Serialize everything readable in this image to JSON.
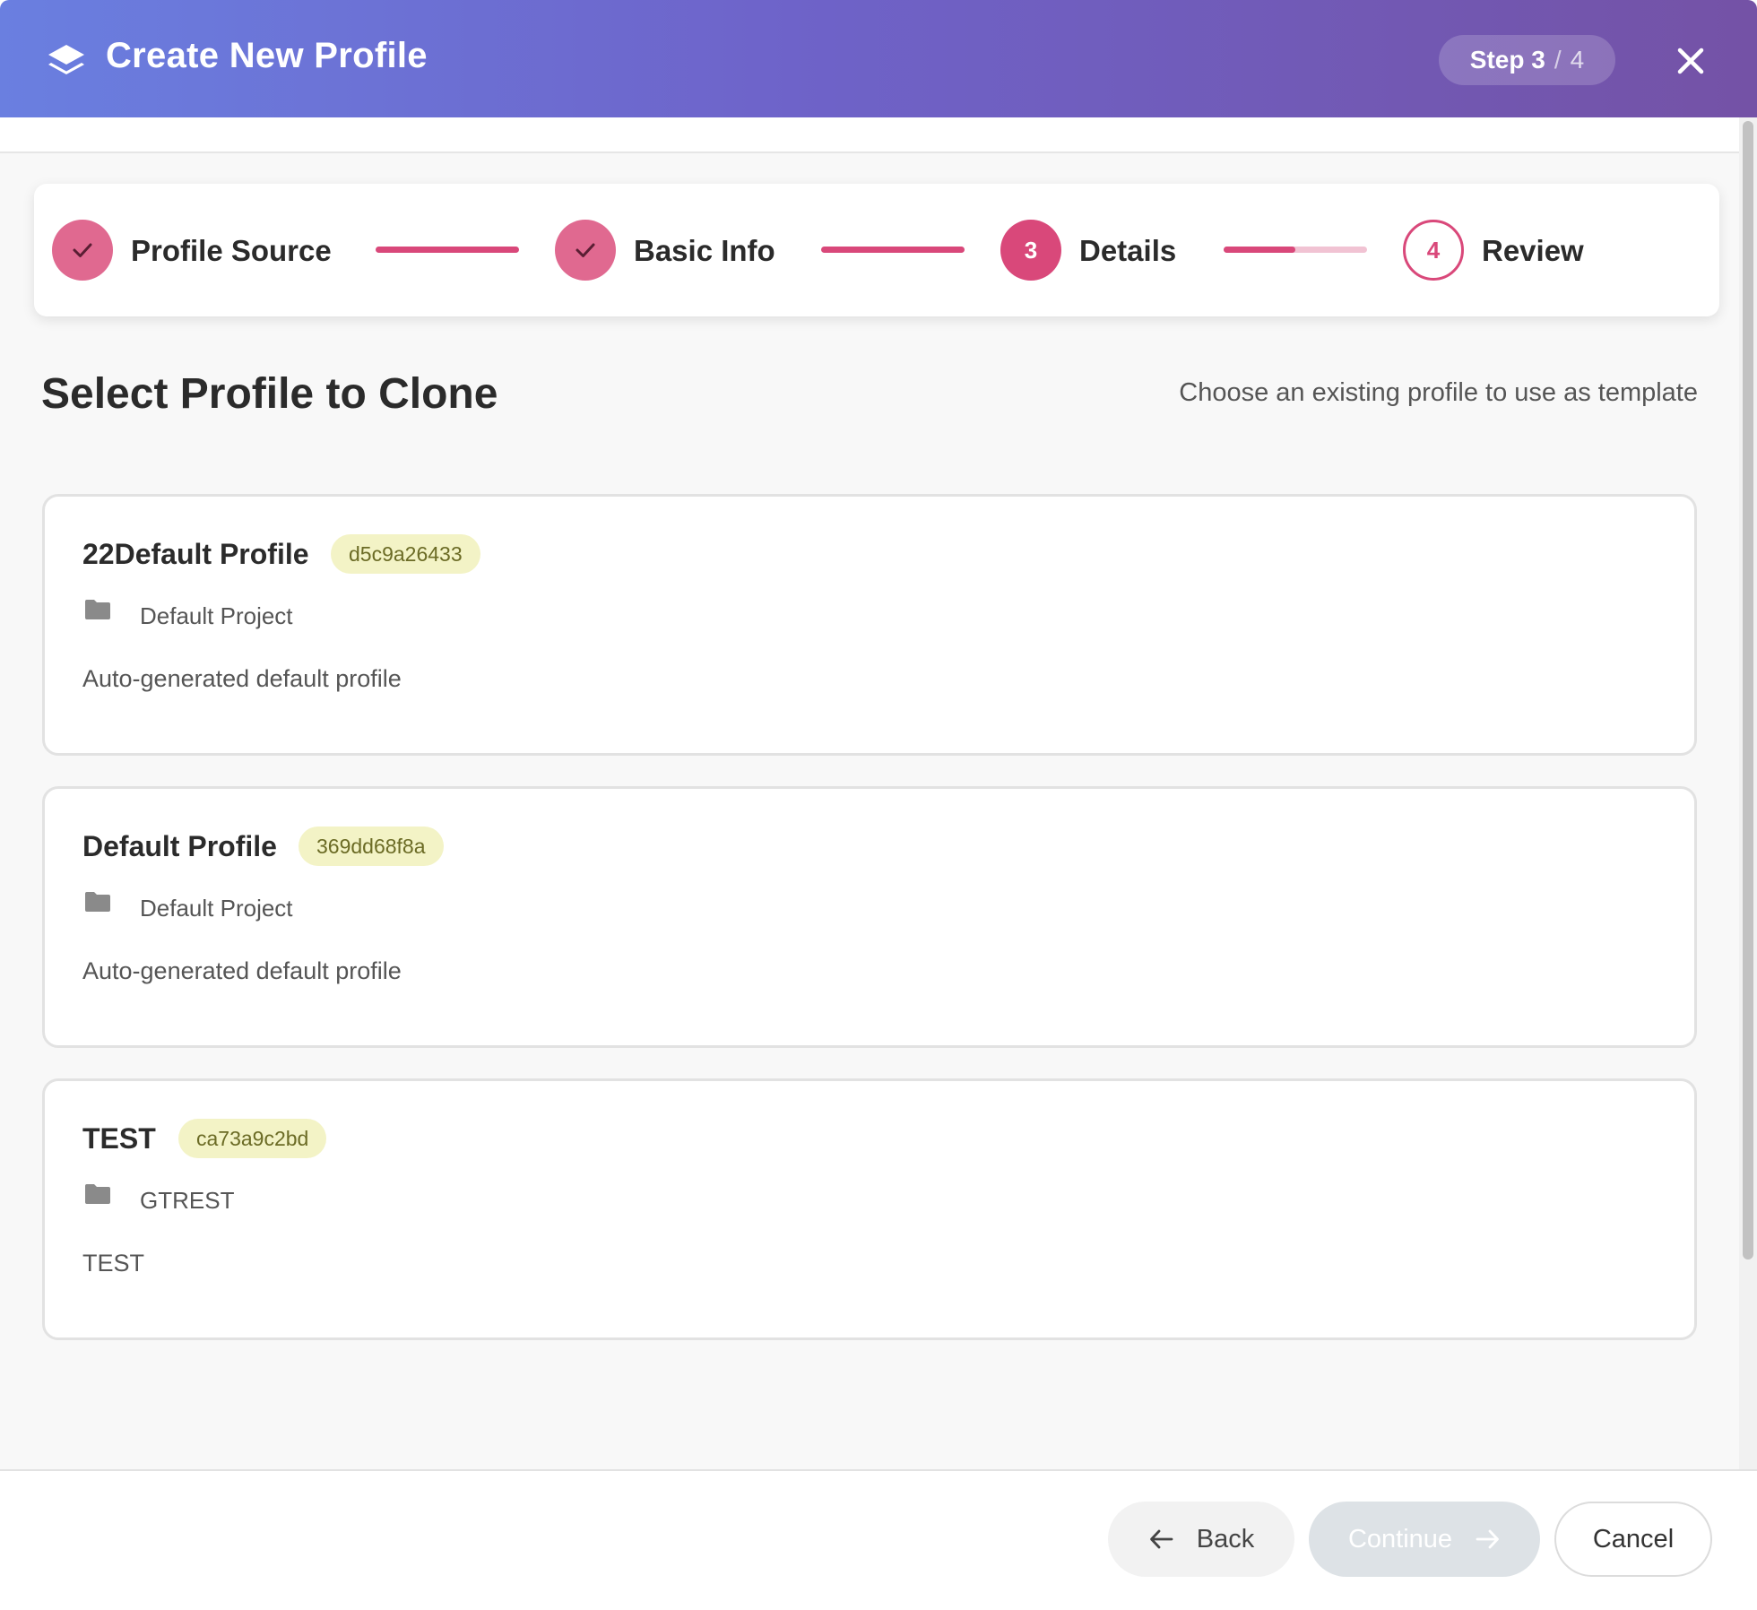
{
  "header": {
    "title": "Create New Profile",
    "logo_icon": "layers-icon",
    "step_current": "Step 3",
    "step_separator": "/",
    "step_total": "4",
    "close_icon": "close-icon"
  },
  "stepper": {
    "steps": [
      {
        "label": "Profile Source",
        "state": "completed",
        "marker": "check-icon"
      },
      {
        "label": "Basic Info",
        "state": "completed",
        "marker": "check-icon"
      },
      {
        "label": "Details",
        "state": "active",
        "marker": "3"
      },
      {
        "label": "Review",
        "state": "upcoming",
        "marker": "4"
      }
    ],
    "connector_progress": [
      1,
      1,
      0.5
    ]
  },
  "section": {
    "title": "Select Profile to Clone",
    "subtitle": "Choose an existing profile to use as template"
  },
  "profiles": [
    {
      "name": "22Default Profile",
      "id": "d5c9a26433",
      "project": "Default Project",
      "description": "Auto-generated default profile"
    },
    {
      "name": "Default Profile",
      "id": "369dd68f8a",
      "project": "Default Project",
      "description": "Auto-generated default profile"
    },
    {
      "name": "TEST",
      "id": "ca73a9c2bd",
      "project": "GTREST",
      "description": "TEST"
    }
  ],
  "footer": {
    "back_label": "Back",
    "continue_label": "Continue",
    "cancel_label": "Cancel"
  },
  "colors": {
    "accent": "#d9487a",
    "header_gradient_start": "#6a7fe0",
    "header_gradient_end": "#7452a6",
    "badge_bg": "#f3f3c6"
  }
}
